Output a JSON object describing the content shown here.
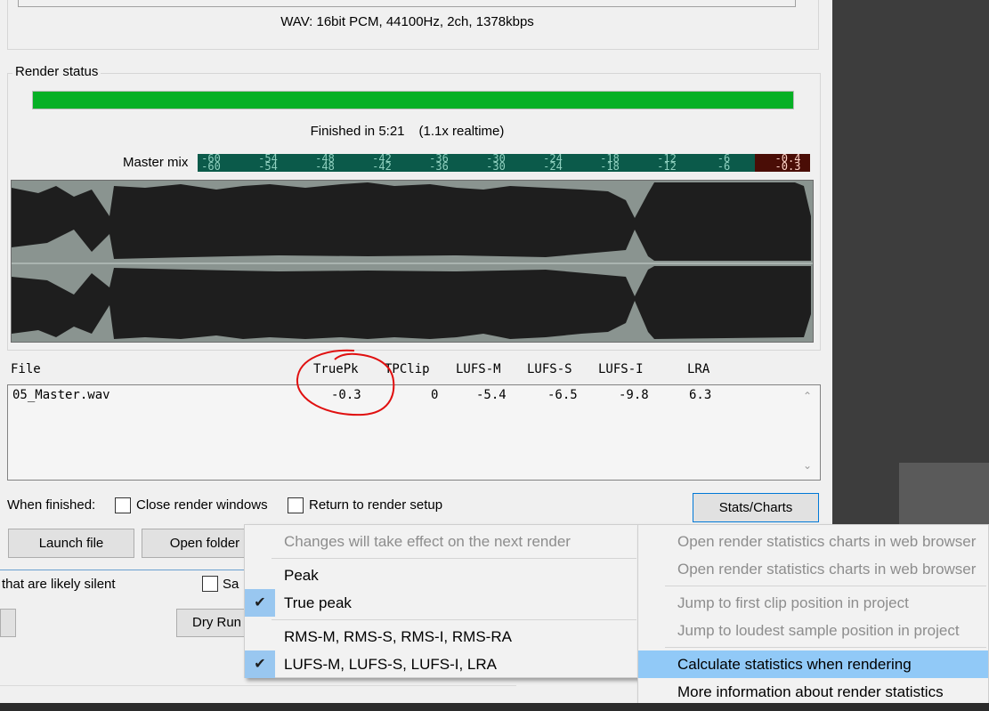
{
  "format_info": "WAV: 16bit PCM, 44100Hz, 2ch, 1378kbps",
  "render_status": {
    "legend": "Render status",
    "progress": 1.0,
    "progress_color": "#06b025",
    "finished_text": "Finished in 5:21",
    "realtime_text": "(1.1x realtime)"
  },
  "meter": {
    "label": "Master mix",
    "ticks": [
      "-60",
      "-54",
      "-48",
      "-42",
      "-36",
      "-30",
      "-24",
      "-18",
      "-12",
      "-6"
    ],
    "clip_top": "-0.4",
    "clip_bottom": "-0.3",
    "color": "#0b5a4a",
    "clip_color": "#4a0d06"
  },
  "stats": {
    "columns": {
      "file": "File",
      "truepk": "TruePk",
      "tpclip": "TPClip",
      "lufs_m": "LUFS-M",
      "lufs_s": "LUFS-S",
      "lufs_i": "LUFS-I",
      "lra": "LRA"
    },
    "rows": [
      {
        "file": "05_Master.wav",
        "truepk": "-0.3",
        "tpclip": "0",
        "lufs_m": "-5.4",
        "lufs_s": "-6.5",
        "lufs_i": "-9.8",
        "lra": "6.3"
      }
    ]
  },
  "when_finished": {
    "label": "When finished:",
    "close_windows": "Close render windows",
    "return_setup": "Return to render setup"
  },
  "buttons": {
    "stats_charts": "Stats/Charts",
    "launch_file": "Launch file",
    "open_folder": "Open folder",
    "dry_run": "Dry Run"
  },
  "lower": {
    "silent_text": "that are likely silent",
    "save_partial": "Sa"
  },
  "menu_left": {
    "items": [
      {
        "label": "Changes will take effect on the next render",
        "disabled": true,
        "checked": false
      },
      {
        "label": "Peak",
        "disabled": false,
        "checked": false
      },
      {
        "label": "True peak",
        "disabled": false,
        "checked": true
      },
      {
        "label": "RMS-M, RMS-S, RMS-I, RMS-RA",
        "disabled": false,
        "checked": false
      },
      {
        "label": "LUFS-M, LUFS-S, LUFS-I, LRA",
        "disabled": false,
        "checked": true
      }
    ]
  },
  "menu_right": {
    "items": [
      {
        "label": "Open render statistics charts in web browser",
        "disabled": true
      },
      {
        "label": "Open render statistics charts in web browser",
        "disabled": true
      },
      {
        "label": "Jump to first clip position in project",
        "disabled": true
      },
      {
        "label": "Jump to loudest sample position in project",
        "disabled": true
      },
      {
        "label": "Calculate statistics when rendering",
        "disabled": false,
        "highlighted": true
      },
      {
        "label": "More information about render statistics",
        "disabled": false
      }
    ]
  }
}
